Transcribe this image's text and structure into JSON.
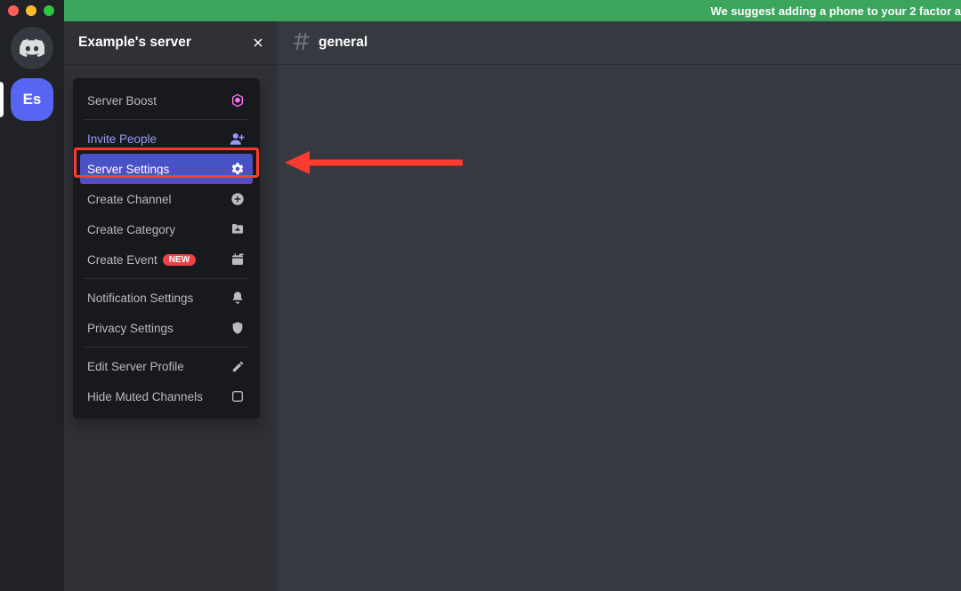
{
  "banner": {
    "text": "We suggest adding a phone to your 2 factor a"
  },
  "server": {
    "name": "Example's server",
    "initials": "Es"
  },
  "channel": {
    "name": "general"
  },
  "menu": {
    "server_boost": "Server Boost",
    "invite_people": "Invite People",
    "server_settings": "Server Settings",
    "create_channel": "Create Channel",
    "create_category": "Create Category",
    "create_event": "Create Event",
    "new_badge": "NEW",
    "notification_settings": "Notification Settings",
    "privacy_settings": "Privacy Settings",
    "edit_server_profile": "Edit Server Profile",
    "hide_muted_channels": "Hide Muted Channels"
  },
  "colors": {
    "blurple": "#5865F2",
    "highlight_red": "#ff3b30",
    "green_banner": "#3BA55D"
  }
}
